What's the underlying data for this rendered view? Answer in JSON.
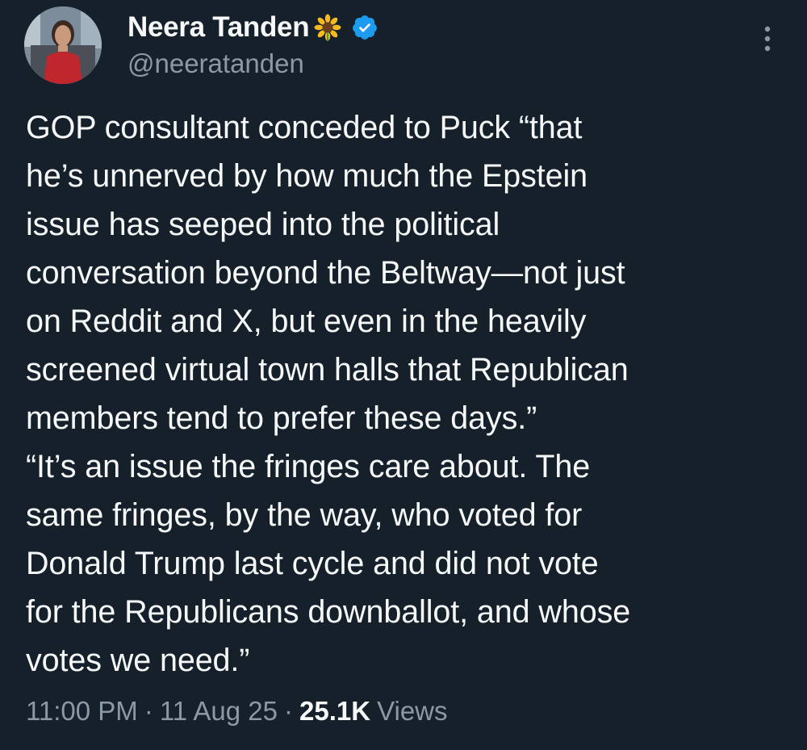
{
  "author": {
    "display_name": "Neera Tanden",
    "handle": "@neeratanden",
    "name_emoji": "sunflower-icon",
    "verified_badge": "verified-badge-icon",
    "verified_color": "#1d9bf0"
  },
  "tweet": {
    "lines": [
      "GOP consultant conceded to Puck “that",
      "he’s unnerved by how much the Epstein",
      "issue has seeped into the political",
      "conversation beyond the Beltway—not just",
      "on Reddit and X, but even in the heavily",
      "screened virtual town halls that Republican",
      "members tend to prefer these days.”",
      "“It’s an issue the fringes care about. The",
      "same fringes, by the way, who voted for",
      "Donald Trump last cycle and did not vote",
      "for the Republicans downballot, and whose",
      "votes we need.”"
    ]
  },
  "meta": {
    "time": "11:00 PM",
    "separator": "·",
    "date": "11 Aug 25",
    "views_count": "25.1K",
    "views_label": "Views"
  },
  "icons": {
    "more": "more-vertical-icon"
  },
  "colors": {
    "background": "#15202b",
    "text": "#f7f9f9",
    "secondary_text": "#8b98a5"
  }
}
